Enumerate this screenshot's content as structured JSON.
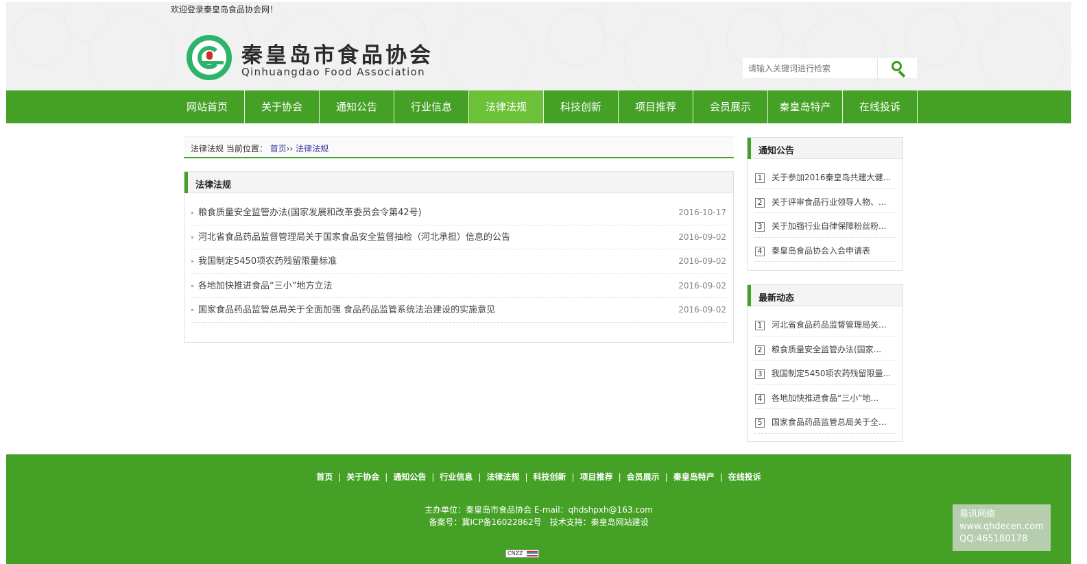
{
  "header": {
    "welcome": "欢迎登录秦皇岛食品协会网！",
    "logo_cn": "秦皇岛市食品协会",
    "logo_en": "Qinhuangdao Food Association",
    "search_placeholder": "请输入关键词进行检索"
  },
  "nav": {
    "items": [
      "网站首页",
      "关于协会",
      "通知公告",
      "行业信息",
      "法律法规",
      "科技创新",
      "项目推荐",
      "会员展示",
      "秦皇岛特产",
      "在线投诉"
    ],
    "active_index": 4
  },
  "breadcrumb": {
    "section": "法律法规",
    "label": "当前位置：",
    "home": "首页",
    "sep": "››",
    "current": "法律法规"
  },
  "list": {
    "title": "法律法规",
    "items": [
      {
        "title": "粮食质量安全监管办法(国家发展和改革委员会令第42号)",
        "date": "2016-10-17"
      },
      {
        "title": "河北省食品药品监督管理局关于国家食品安全监督抽检（河北承担）信息的公告",
        "date": "2016-09-02"
      },
      {
        "title": "我国制定5450项农药残留限量标准",
        "date": "2016-09-02"
      },
      {
        "title": "各地加快推进食品“三小”地方立法",
        "date": "2016-09-02"
      },
      {
        "title": "国家食品药品监管总局关于全面加强 食品药品监管系统法治建设的实施意见",
        "date": "2016-09-02"
      }
    ]
  },
  "sidebar": {
    "notices": {
      "title": "通知公告",
      "items": [
        {
          "num": "1",
          "title": "关于参加2016秦皇岛共建大健..."
        },
        {
          "num": "2",
          "title": "关于评审食品行业领导人物、..."
        },
        {
          "num": "3",
          "title": "关于加强行业自律保障粉丝粉..."
        },
        {
          "num": "4",
          "title": "秦皇岛食品协会入会申请表"
        }
      ]
    },
    "news": {
      "title": "最新动态",
      "items": [
        {
          "num": "1",
          "title": "河北省食品药品监督管理局关..."
        },
        {
          "num": "2",
          "title": "粮食质量安全监管办法(国家..."
        },
        {
          "num": "3",
          "title": "我国制定5450项农药残留限量..."
        },
        {
          "num": "4",
          "title": "各地加快推进食品“三小”地..."
        },
        {
          "num": "5",
          "title": "国家食品药品监管总局关于全..."
        }
      ]
    }
  },
  "footer": {
    "nav": [
      "首页",
      "关于协会",
      "通知公告",
      "行业信息",
      "法律法规",
      "科技创新",
      "项目推荐",
      "会员展示",
      "秦皇岛特产",
      "在线投诉"
    ],
    "sep": "|",
    "host": "主办单位：秦皇岛市食品协会 E-mail：qhdshpxh@163.com",
    "icp": "备案号：冀ICP备16022862号　技术支持：秦皇岛网站建设",
    "badge": "CNZZ"
  },
  "watermark": {
    "line1": "易讯网络",
    "line2": "www.qhdecen.com",
    "line3": "QQ:465180178"
  },
  "colors": {
    "brand_green": "#45a126",
    "nav_active": "#6cc138",
    "logo_green": "#2db46a"
  }
}
